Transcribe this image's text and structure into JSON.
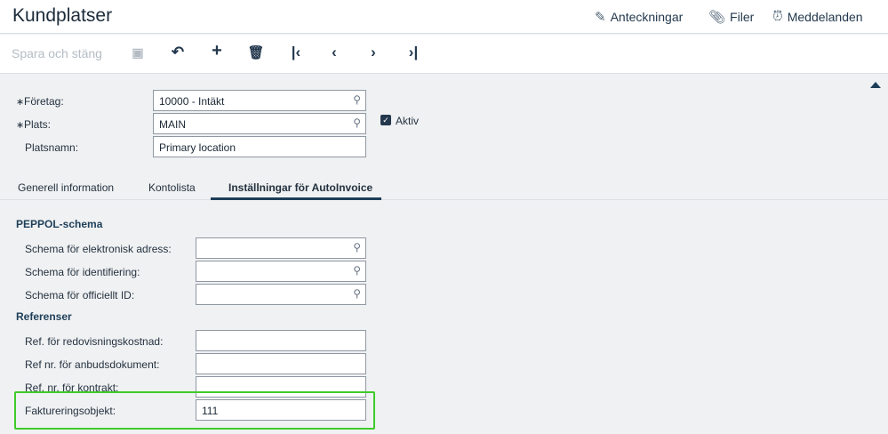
{
  "header": {
    "title": "Kundplatser",
    "links": [
      {
        "icon": "edit-note-icon",
        "label": "Anteckningar"
      },
      {
        "icon": "paperclip-icon",
        "label": "Filer"
      },
      {
        "icon": "alarm-clock-icon",
        "label": "Meddelanden"
      }
    ]
  },
  "toolbar": {
    "save_close": "Spara och stäng",
    "icons": [
      "save-icon",
      "undo-icon",
      "add-icon",
      "delete-icon",
      "first-record-icon",
      "previous-icon",
      "next-icon",
      "last-record-icon"
    ]
  },
  "form": {
    "foretag": {
      "label": "Företag:",
      "value": "10000 - Intäkt",
      "required": true
    },
    "plats": {
      "label": "Plats:",
      "value": "MAIN",
      "required": true
    },
    "platsnamn": {
      "label": "Platsnamn:",
      "value": "Primary location"
    },
    "aktiv": {
      "label": "Aktiv",
      "checked": true
    }
  },
  "tabs": [
    {
      "label": "Generell information"
    },
    {
      "label": "Kontolista"
    },
    {
      "label": "Inställningar för AutoInvoice",
      "active": true
    }
  ],
  "peppol": {
    "title": "PEPPOL-schema",
    "fields": [
      {
        "label": "Schema för elektronisk adress:",
        "value": ""
      },
      {
        "label": "Schema för identifiering:",
        "value": ""
      },
      {
        "label": "Schema för officiellt ID:",
        "value": ""
      }
    ]
  },
  "referenser": {
    "title": "Referenser",
    "fields": [
      {
        "label": "Ref. för redovisningskostnad:",
        "value": ""
      },
      {
        "label": "Ref nr. för anbudsdokument:",
        "value": ""
      },
      {
        "label": "Ref. nr. för kontrakt:",
        "value": ""
      },
      {
        "label": "Faktureringsobjekt:",
        "value": "111"
      }
    ]
  },
  "colors": {
    "accent": "#1d3e58",
    "highlight": "#3ecb2a"
  }
}
